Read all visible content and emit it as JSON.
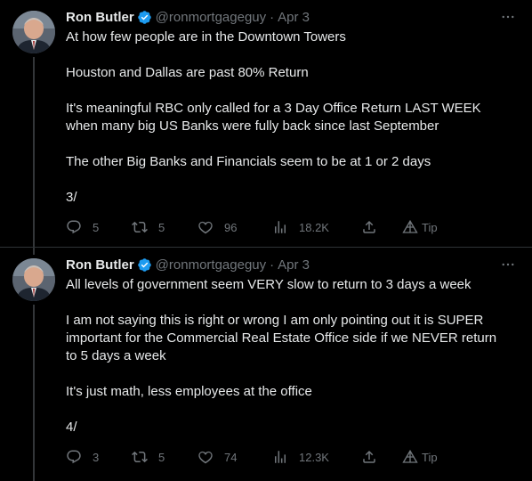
{
  "tweets": [
    {
      "author_name": "Ron Butler",
      "handle": "@ronmortgageguy",
      "separator": "·",
      "date": "Apr 3",
      "paragraphs": [
        "At how few people are in the Downtown Towers",
        "Houston and Dallas are past 80% Return",
        "It's meaningful RBC only called for a 3 Day Office Return LAST WEEK when many big US Banks were fully back since last September",
        "The other Big Banks and Financials seem to be at 1 or 2 days",
        "3/"
      ],
      "replies": "5",
      "retweets": "5",
      "likes": "96",
      "views": "18.2K",
      "tip_label": "Tip"
    },
    {
      "author_name": "Ron Butler",
      "handle": "@ronmortgageguy",
      "separator": "·",
      "date": "Apr 3",
      "paragraphs": [
        "All levels of government seem VERY slow to return to 3 days a week",
        "I am not saying this is right or wrong I am only pointing out it is SUPER important for the Commercial Real Estate Office side if we NEVER return to 5 days a week",
        "It's just math, less employees at the office",
        "4/"
      ],
      "replies": "3",
      "retweets": "5",
      "likes": "74",
      "views": "12.3K",
      "tip_label": "Tip"
    }
  ],
  "icons": {
    "verified": "verified-badge-icon",
    "more": "more-dots-icon",
    "reply": "reply-bubble-icon",
    "retweet": "retweet-icon",
    "like": "heart-icon",
    "views": "views-bar-icon",
    "share": "share-icon",
    "tip": "tip-icon"
  },
  "colors": {
    "background": "#000000",
    "text": "#e7e9ea",
    "muted": "#71767b",
    "verified": "#1d9bf0",
    "divider": "#2f3336"
  }
}
